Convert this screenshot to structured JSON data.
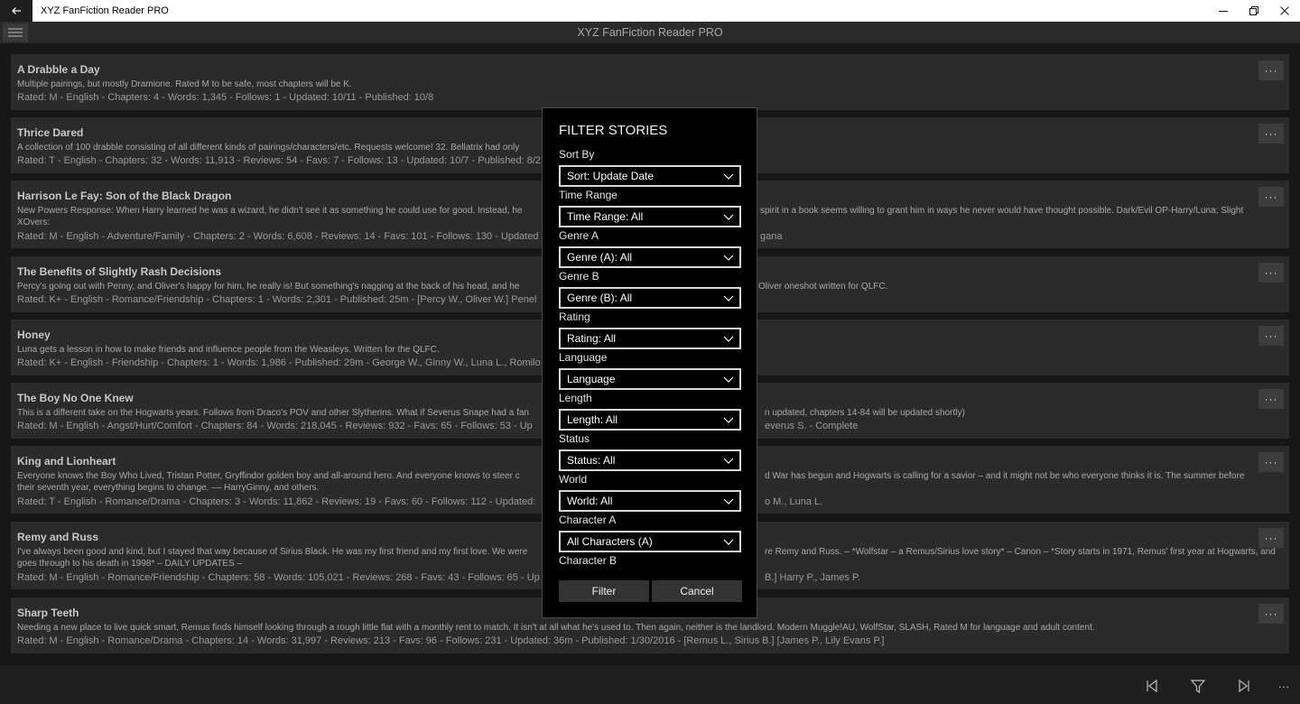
{
  "window": {
    "title": "XYZ FanFiction Reader PRO",
    "back_icon": "arrow-left-icon",
    "minimize_icon": "minimize-icon",
    "restore_icon": "restore-icon",
    "close_icon": "close-icon"
  },
  "header": {
    "title": "XYZ FanFiction Reader PRO",
    "menu_icon": "hamburger-icon"
  },
  "stories": [
    {
      "title": "A Drabble a Day",
      "summary": "Multiple pairings, but mostly Dramione. Rated M to be safe, most chapters will be K.",
      "meta": "Rated: M - English - Chapters: 4 - Words: 1,345 - Follows: 1 - Updated: 10/11 - Published: 10/8"
    },
    {
      "title": "Thrice Dared",
      "summary": "A collection of 100 drabble consisting of all different kinds of pairings/characters/etc. Requests welcome! 32. Bellatrix had only",
      "meta": "Rated: T - English - Chapters: 32 - Words: 11,913 - Reviews: 54 - Favs: 7 - Follows: 13 - Updated: 10/7 - Published: 8/2"
    },
    {
      "title": "Harrison Le Fay: Son of the Black Dragon",
      "summary": "New Powers Response: When Harry learned he was a wizard, he didn't see it as something he could use for good. Instead, he",
      "summary_right": "spirit in a book seems willing to grant him in ways he never would have thought possible. Dark/Evil OP-Harry/Luna; Slight",
      "summary_line2": "XOvers:",
      "meta": "Rated: M - English - Adventure/Family - Chapters: 2 - Words: 6,608 - Reviews: 14 - Favs: 101 - Follows: 130 - Updated",
      "meta_right": "gana"
    },
    {
      "title": "The Benefits of Slightly Rash Decisions",
      "summary": "Percy's going out with Penny, and Oliver's happy for him, he really is! But something's nagging at the back of his head, and he",
      "summary_right": "Oliver oneshot written for QLFC.",
      "meta": "Rated: K+ - English - Romance/Friendship - Chapters: 1 - Words: 2,301 - Published: 25m - [Percy W., Oliver W.] Penel"
    },
    {
      "title": "Honey",
      "summary": "Luna gets a lesson in how to make friends and influence people from the Weasleys. Written for the QLFC.",
      "meta": "Rated: K+ - English - Friendship - Chapters: 1 - Words: 1,986 - Published: 29m - George W., Ginny W., Luna L., Romilo"
    },
    {
      "title": "The Boy No One Knew",
      "summary": "This is a different take on the Hogwarts years. Follows from Draco's POV and other Slytherins. What if Severus Snape had a fan",
      "summary_right": "n updated, chapters 14-84 will be updated shortly)",
      "meta": "Rated: M - English - Angst/Hurt/Comfort - Chapters: 84 - Words: 218,045 - Reviews: 932 - Favs: 65 - Follows: 53 - Up",
      "meta_right": "everus S. - Complete"
    },
    {
      "title": "King and Lionheart",
      "summary": "Everyone knows the Boy Who Lived, Tristan Potter, Gryffindor golden boy and all-around hero. And everyone knows to steer c",
      "summary_right": "d War has begun and Hogwarts is calling for a savior – and it might not be who everyone thinks it is. The summer before",
      "summary_line2": "their seventh year, everything begins to change. –– HarryGinny, and others.",
      "meta": "Rated: T - English - Romance/Drama - Chapters: 3 - Words: 11,862 - Reviews: 19 - Favs: 60 - Follows: 112 - Updated:",
      "meta_right": "o M., Luna L."
    },
    {
      "title": "Remy and Russ",
      "summary": "I've always been good and kind, but I stayed that way because of Sirius Black. He was my first friend and my first love. We were",
      "summary_right": "re Remy and Russ. – *Wolfstar – a Remus/Sirius love story* – Canon – *Story starts in 1971, Remus' first year at Hogwarts, and",
      "summary_line2": "goes through to his death in 1998* – DAILY UPDATES –",
      "meta": "Rated: M - English - Romance/Friendship - Chapters: 58 - Words: 105,021 - Reviews: 268 - Favs: 43 - Follows: 65 - Up",
      "meta_right": "B.] Harry P., James P."
    },
    {
      "title": "Sharp Teeth",
      "summary": "Needing a new place to live quick smart, Remus finds himself looking through a rough little flat with a monthly rent to match. It isn't at all what he's used to. Then again, neither is the landlord. Modern Muggle!AU, WolfStar, SLASH, Rated M for language and adult content.",
      "meta": "Rated: M - English - Romance/Drama - Chapters: 14 - Words: 31,997 - Reviews: 213 - Favs: 96 - Follows: 231 - Updated: 36m - Published: 1/30/2016 - [Remus L., Sirius B.] [James P., Lily Evans P.]"
    }
  ],
  "more_label": "···",
  "filter": {
    "title": "FILTER STORIES",
    "fields": [
      {
        "label": "Sort By",
        "value": "Sort: Update Date"
      },
      {
        "label": "Time Range",
        "value": "Time Range: All"
      },
      {
        "label": "Genre A",
        "value": "Genre (A): All"
      },
      {
        "label": "Genre B",
        "value": "Genre (B): All"
      },
      {
        "label": "Rating",
        "value": "Rating: All"
      },
      {
        "label": "Language",
        "value": "Language"
      },
      {
        "label": "Length",
        "value": "Length: All"
      },
      {
        "label": "Status",
        "value": "Status: All"
      },
      {
        "label": "World",
        "value": "World: All"
      },
      {
        "label": "Character A",
        "value": "All Characters (A)"
      }
    ],
    "last_label": "Character B",
    "filter_button": "Filter",
    "cancel_button": "Cancel"
  },
  "commandbar": {
    "prev_icon": "previous-page-icon",
    "filter_icon": "filter-icon",
    "next_icon": "next-page-icon",
    "more_label": "···"
  }
}
